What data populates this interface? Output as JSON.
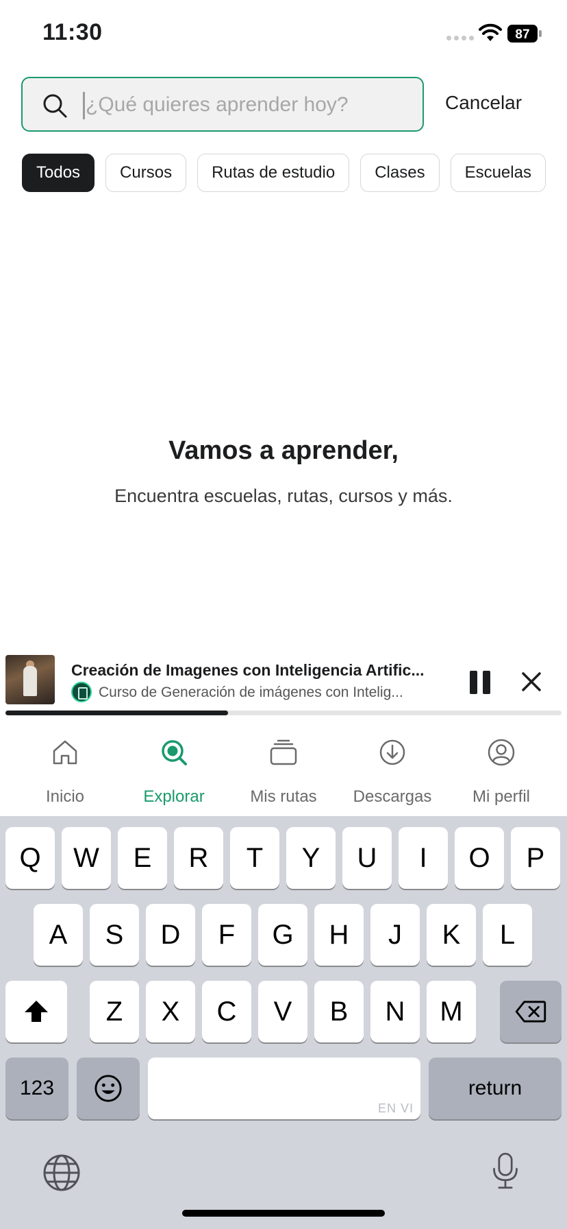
{
  "status_bar": {
    "time": "11:30",
    "battery": "87"
  },
  "search": {
    "placeholder": "¿Qué quieres aprender hoy?",
    "value": "",
    "cancel_label": "Cancelar"
  },
  "filters": [
    {
      "label": "Todos",
      "active": true
    },
    {
      "label": "Cursos",
      "active": false
    },
    {
      "label": "Rutas de estudio",
      "active": false
    },
    {
      "label": "Clases",
      "active": false
    },
    {
      "label": "Escuelas",
      "active": false
    }
  ],
  "empty_state": {
    "title": "Vamos a aprender,",
    "subtitle": "Encuentra escuelas, rutas, cursos y más."
  },
  "player": {
    "title": "Creación de Imagenes con Inteligencia Artific...",
    "subtitle": "Curso de Generación de imágenes con Intelig...",
    "progress": 0.4
  },
  "tabs": [
    {
      "label": "Inicio",
      "icon": "home-icon",
      "active": false
    },
    {
      "label": "Explorar",
      "icon": "explore-search-icon",
      "active": true
    },
    {
      "label": "Mis rutas",
      "icon": "stack-icon",
      "active": false
    },
    {
      "label": "Descargas",
      "icon": "download-icon",
      "active": false
    },
    {
      "label": "Mi perfil",
      "icon": "profile-icon",
      "active": false
    }
  ],
  "keyboard": {
    "row1": [
      "Q",
      "W",
      "E",
      "R",
      "T",
      "Y",
      "U",
      "I",
      "O",
      "P"
    ],
    "row2": [
      "A",
      "S",
      "D",
      "F",
      "G",
      "H",
      "J",
      "K",
      "L"
    ],
    "row3": [
      "Z",
      "X",
      "C",
      "V",
      "B",
      "N",
      "M"
    ],
    "numbers_label": "123",
    "return_label": "return",
    "space_tag": "EN VI"
  },
  "colors": {
    "accent": "#1a9a6c",
    "text": "#1c1d1f",
    "keyboard_bg": "#d1d4db"
  }
}
